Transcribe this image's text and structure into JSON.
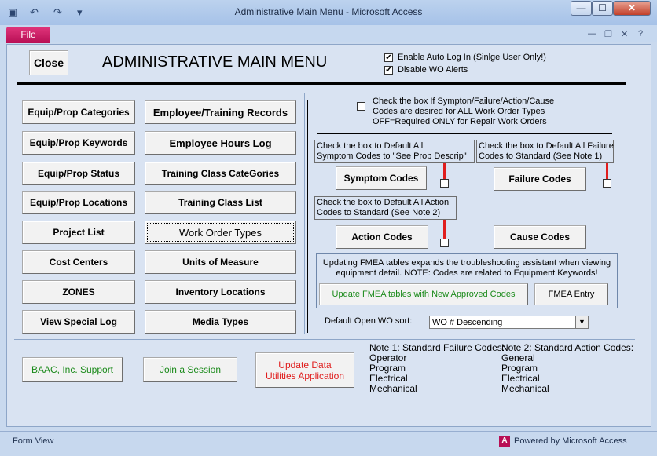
{
  "window": {
    "title": "Administrative Main Menu  -  Microsoft Access"
  },
  "ribbon": {
    "file_tab": "File"
  },
  "header": {
    "close_label": "Close",
    "title": "ADMINISTRATIVE MAIN MENU",
    "auto_login_label": "Enable Auto Log In (Sinlge User Only!)",
    "disable_alerts_label": "Disable WO Alerts"
  },
  "left_buttons": {
    "col1": [
      "Equip/Prop Categories",
      "Equip/Prop Keywords",
      "Equip/Prop Status",
      "Equip/Prop Locations",
      "Project List",
      "Cost Centers",
      "ZONES",
      "View Special Log"
    ],
    "col2": [
      "Employee/Training Records",
      "Employee Hours Log",
      "Training Class CateGories",
      "Training Class List",
      "Work Order Types",
      "Units of Measure",
      "Inventory Locations",
      "Media Types"
    ]
  },
  "right": {
    "required_note": [
      "Check the box If Sympton/Failure/Action/Cause",
      "Codes are desired for ALL Work Order Types",
      "OFF=Required ONLY for Repair Work Orders"
    ],
    "symptom_note": [
      "Check the box to Default All",
      "Symptom Codes to \"See Prob Descrip\""
    ],
    "failure_note": [
      "Check the box to Default All Failure",
      "Codes to Standard (See Note 1)"
    ],
    "action_note": [
      "Check the box to Default All Action",
      "Codes to Standard (See Note 2)"
    ],
    "symptom_btn": "Symptom Codes",
    "failure_btn": "Failure Codes",
    "action_btn": "Action Codes",
    "cause_btn": "Cause Codes",
    "fmea_note": [
      "Updating FMEA tables expands the troubleshooting assistant when viewing",
      "equipment detail.  NOTE:  Codes are related to Equipment Keywords!"
    ],
    "fmea_update_btn": "Update FMEA tables with New Approved Codes",
    "fmea_entry_btn": "FMEA Entry",
    "sort_label": "Default Open WO sort:",
    "sort_value": "WO # Descending"
  },
  "bottom": {
    "support_btn": "BAAC, Inc. Support",
    "session_btn": "Join a Session",
    "update_btn": [
      "Update Data",
      "Utilities Application"
    ],
    "note1_title": "Note 1: Standard Failure Codes:",
    "note1_items": [
      "Operator",
      "Program",
      "Electrical",
      "Mechanical"
    ],
    "note2_title": "Note 2: Standard Action Codes:",
    "note2_items": [
      "General",
      "Program",
      "Electrical",
      "Mechanical"
    ]
  },
  "status": {
    "left": "Form View",
    "right": "Powered by Microsoft Access"
  },
  "colors": {
    "accent": "#b80f55",
    "link_green": "#1a8a1a",
    "red": "#e01d1d"
  }
}
